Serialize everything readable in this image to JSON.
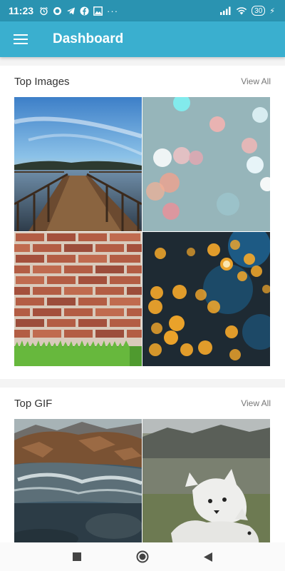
{
  "status_bar": {
    "time": "11:23",
    "battery": "30",
    "icons": [
      "alarm-icon",
      "cast-icon",
      "telegram-icon",
      "facebook-icon",
      "gallery-icon",
      "more-dots-icon",
      "signal-icon",
      "wifi-icon",
      "charging-icon"
    ],
    "more": "···",
    "charge": "⚡"
  },
  "app_bar": {
    "title": "Dashboard",
    "menu_icon": "hamburger-icon"
  },
  "sections": [
    {
      "title": "Top Images",
      "view_all": "View All",
      "tiles": [
        "pier-sunset",
        "bokeh-teal",
        "brick-wall-grass",
        "bokeh-gold"
      ]
    },
    {
      "title": "Top GIF",
      "view_all": "View All",
      "tiles": [
        "river-rocks",
        "white-wolves"
      ]
    }
  ],
  "colors": {
    "status_bar": "#2a93b1",
    "app_bar": "#3aafcf"
  },
  "nav_bar": {
    "buttons": [
      "recents-square-icon",
      "home-circle-icon",
      "back-triangle-icon"
    ]
  }
}
